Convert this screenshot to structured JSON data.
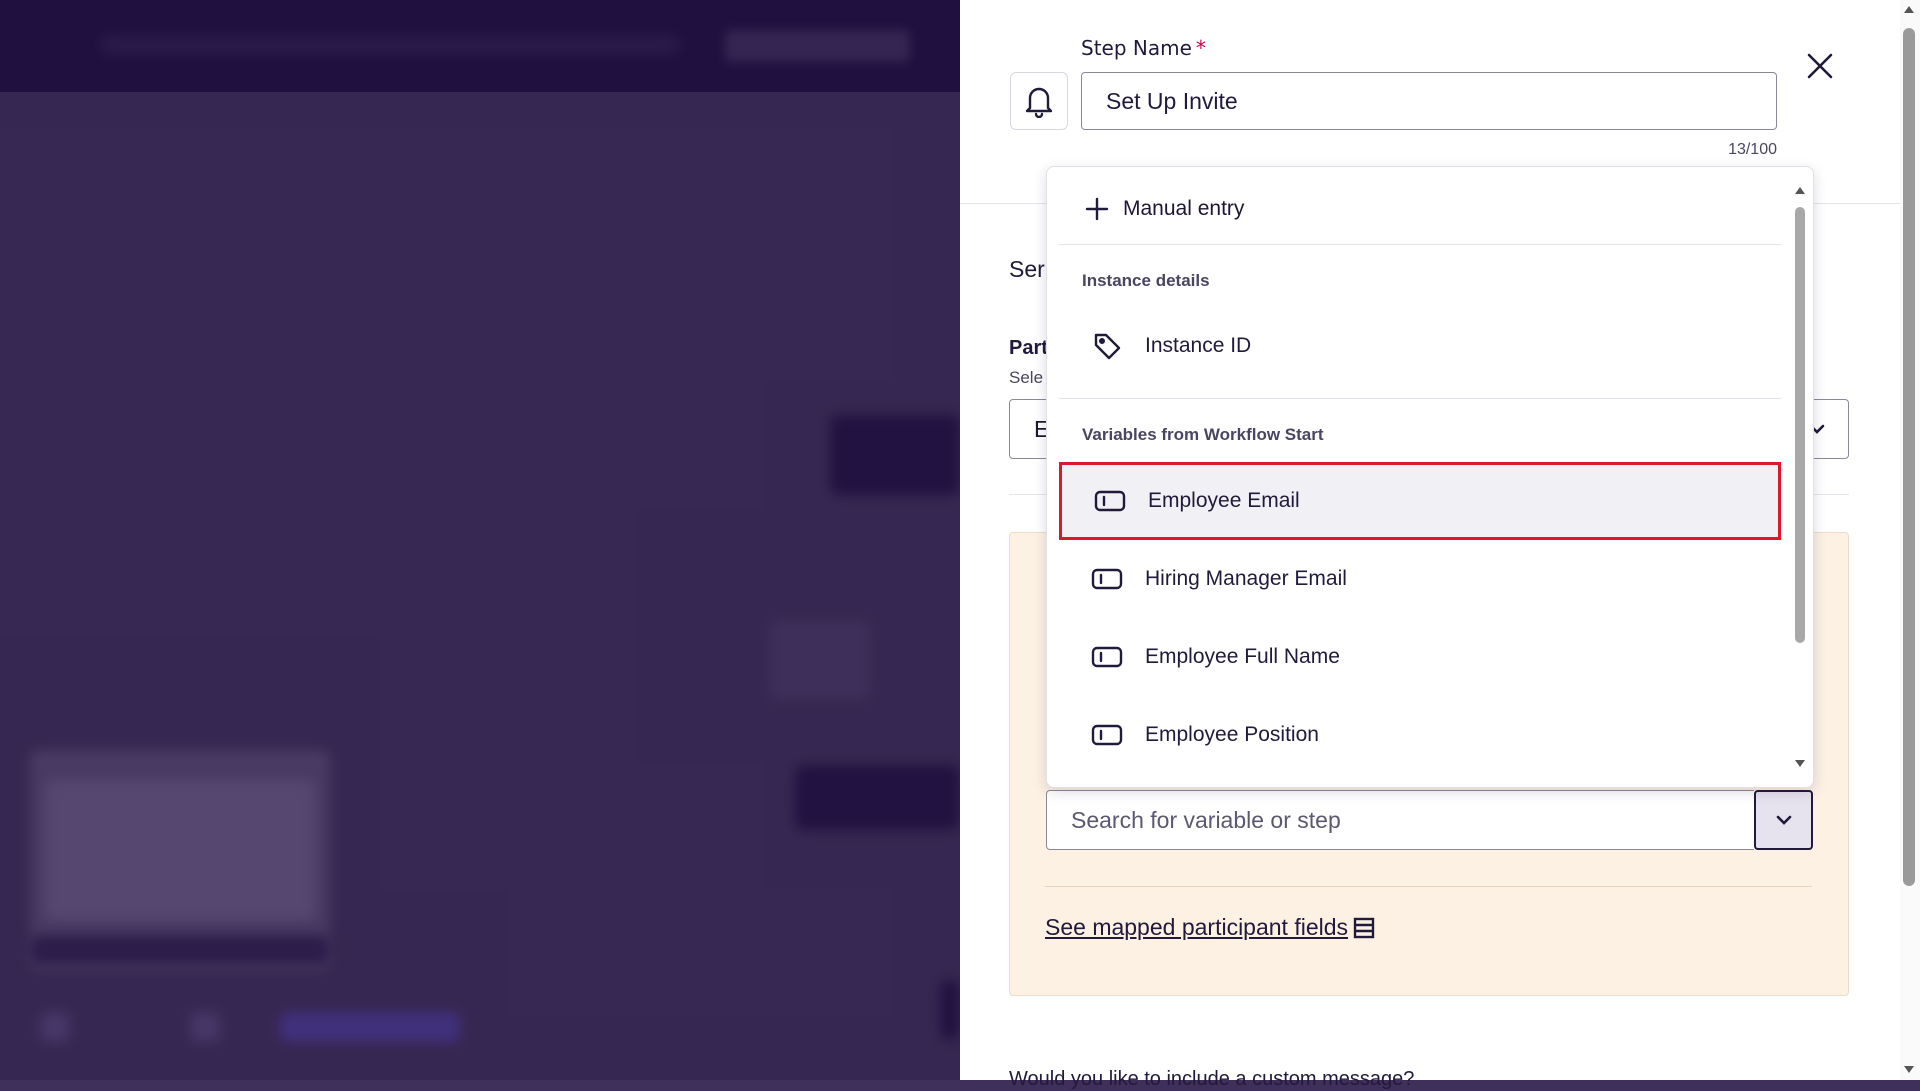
{
  "step": {
    "label": "Step Name",
    "required_mark": "*",
    "value": "Set Up Invite",
    "char_count": "13/100"
  },
  "partial_labels": {
    "send": "Ser",
    "participant": "Part",
    "select_hint": "Sele",
    "select_value": "E"
  },
  "dropdown": {
    "manual_entry": "Manual entry",
    "sections": [
      {
        "header": "Instance details",
        "items": [
          {
            "label": "Instance ID",
            "icon": "tag-icon"
          }
        ]
      },
      {
        "header": "Variables from Workflow Start",
        "items": [
          {
            "label": "Employee Email",
            "icon": "variable-icon",
            "highlighted": true
          },
          {
            "label": "Hiring Manager Email",
            "icon": "variable-icon"
          },
          {
            "label": "Employee Full Name",
            "icon": "variable-icon"
          },
          {
            "label": "Employee Position",
            "icon": "variable-icon"
          }
        ]
      }
    ]
  },
  "search": {
    "placeholder": "Search for variable or step"
  },
  "mapped_link": "See mapped participant fields",
  "custom_message": "Would you like to include a custom message?",
  "colors": {
    "highlight_border": "#e0162b",
    "required": "#d0004b",
    "panel_bg": "#fdf1e4",
    "brand_dark": "#1d0b3d"
  }
}
